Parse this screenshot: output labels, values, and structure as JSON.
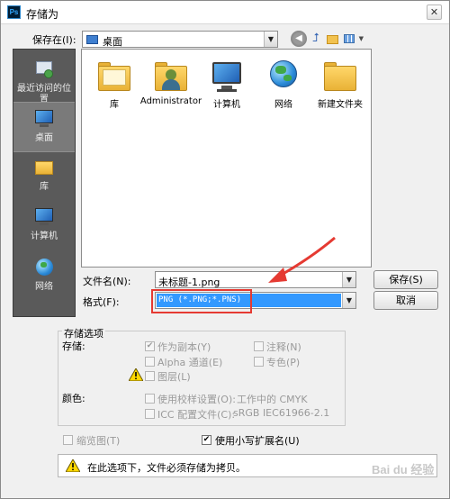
{
  "window": {
    "title": "存储为",
    "app_badge": "Ps",
    "close_glyph": "✕"
  },
  "location": {
    "label": "保存在(I):",
    "value": "桌面"
  },
  "toolbar": {
    "icons": [
      "back-icon",
      "up-folder-icon",
      "new-folder-icon",
      "view-menu-icon"
    ]
  },
  "places": [
    {
      "label": "最近访问的位置",
      "icon": "recent-places-icon"
    },
    {
      "label": "桌面",
      "icon": "desktop-icon",
      "selected": true
    },
    {
      "label": "库",
      "icon": "libraries-icon"
    },
    {
      "label": "计算机",
      "icon": "computer-icon"
    },
    {
      "label": "网络",
      "icon": "network-icon"
    }
  ],
  "files": [
    {
      "label": "库",
      "icon": "libraries-icon"
    },
    {
      "label": "Administrator",
      "icon": "user-folder-icon"
    },
    {
      "label": "计算机",
      "icon": "computer-icon"
    },
    {
      "label": "网络",
      "icon": "network-icon"
    },
    {
      "label": "新建文件夹",
      "icon": "folder-icon"
    }
  ],
  "filename": {
    "label": "文件名(N):",
    "value": "未标题-1.png"
  },
  "format": {
    "label": "格式(F):",
    "value": "PNG (*.PNG;*.PNS)"
  },
  "buttons": {
    "save": "保存(S)",
    "cancel": "取消"
  },
  "options": {
    "group_title": "存储选项",
    "storage_label": "存储:",
    "as_copy": "作为副本(Y)",
    "annotations": "注释(N)",
    "alpha": "Alpha 通道(E)",
    "spot_colors": "专色(P)",
    "layers": "图层(L)",
    "color_label": "颜色:",
    "use_proof": "使用校样设置(O):",
    "proof_value": "工作中的 CMYK",
    "icc": "ICC 配置文件(C):",
    "icc_value": "sRGB IEC61966-2.1",
    "thumbnail": "缩览图(T)",
    "lowercase_ext": "使用小写扩展名(U)",
    "check_glyph": "✔"
  },
  "notice": {
    "text": "在此选项下，文件必须存储为拷贝。"
  },
  "watermark": "Bai du 经验",
  "annotation_color": "#e53a32"
}
